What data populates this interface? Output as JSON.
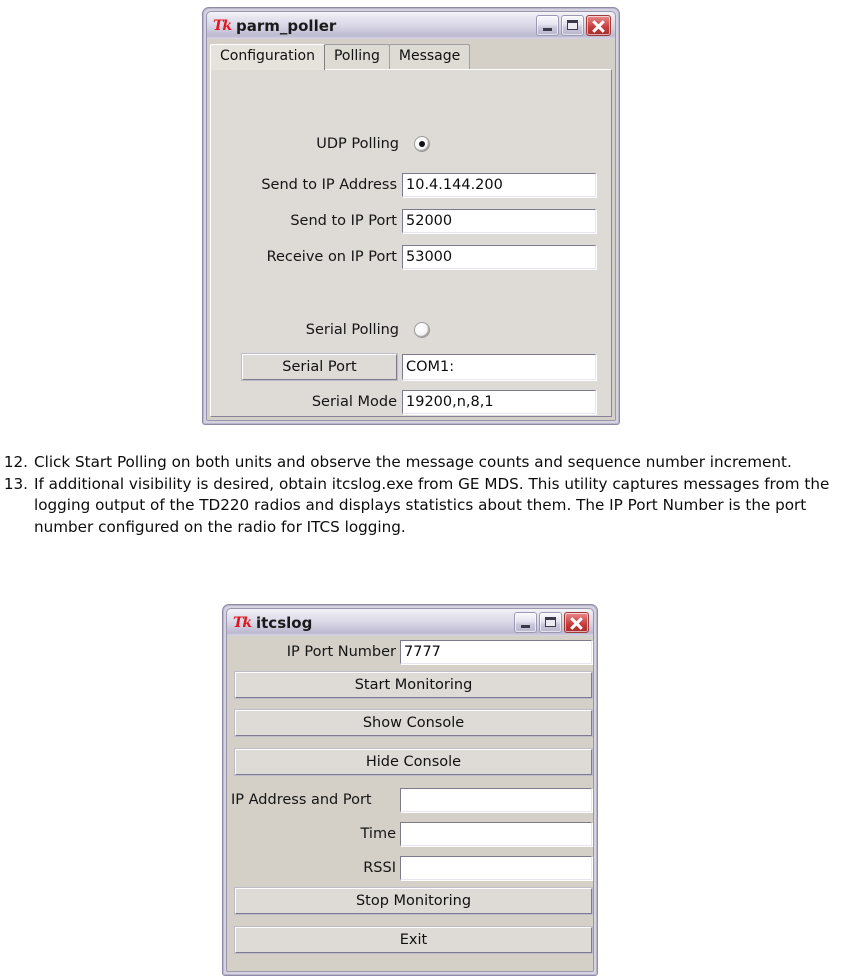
{
  "document": {
    "steps": [
      {
        "number": "12.",
        "text": "Click Start Polling on both units and observe the message counts and sequence number increment."
      },
      {
        "number": "13.",
        "text": "If additional visibility is desired, obtain itcslog.exe from GE MDS.  This utility captures messages from the logging output of the TD220 radios and displays statistics about them.  The IP Port Number is the port number configured on the radio for ITCS logging."
      }
    ]
  },
  "parm_poller_window": {
    "title": "parm_poller",
    "app_icon": "tk-feather-icon",
    "buttons": {
      "minimize": "minimize-icon",
      "maximize": "maximize-icon",
      "close": "close-icon"
    },
    "tabs": [
      {
        "label": "Configuration",
        "active": true
      },
      {
        "label": "Polling",
        "active": false
      },
      {
        "label": "Message",
        "active": false
      }
    ],
    "fields": {
      "udp_polling_label": "UDP Polling",
      "udp_polling_selected": true,
      "send_to_ip_address_label": "Send to IP Address",
      "send_to_ip_address_value": "10.4.144.200",
      "send_to_ip_port_label": "Send to IP Port",
      "send_to_ip_port_value": "52000",
      "receive_on_ip_port_label": "Receive on IP Port",
      "receive_on_ip_port_value": "53000",
      "serial_polling_label": "Serial Polling",
      "serial_polling_selected": false,
      "serial_port_button": "Serial Port",
      "serial_port_value": "COM1:",
      "serial_mode_label": "Serial Mode",
      "serial_mode_value": "19200,n,8,1"
    }
  },
  "itcslog_window": {
    "title": "itcslog",
    "app_icon": "tk-feather-icon",
    "buttons": {
      "minimize": "minimize-icon",
      "maximize": "maximize-icon",
      "close": "close-icon"
    },
    "fields": {
      "ip_port_number_label": "IP Port Number",
      "ip_port_number_value": "7777",
      "start_monitoring_button": "Start Monitoring",
      "show_console_button": "Show Console",
      "hide_console_button": "Hide Console",
      "ip_address_and_port_label": "IP Address and Port",
      "ip_address_and_port_value": "",
      "time_label": "Time",
      "time_value": "",
      "rssi_label": "RSSI",
      "rssi_value": "",
      "stop_monitoring_button": "Stop Monitoring",
      "exit_button": "Exit"
    }
  },
  "colors": {
    "window_face": "#d4d0c8",
    "titlebar_light": "#f4f3f8",
    "titlebar_dark": "#bcb9d0",
    "close_red": "#c23b3b",
    "tk_logo_red": "#e4121c",
    "entry_white": "#ffffff"
  }
}
